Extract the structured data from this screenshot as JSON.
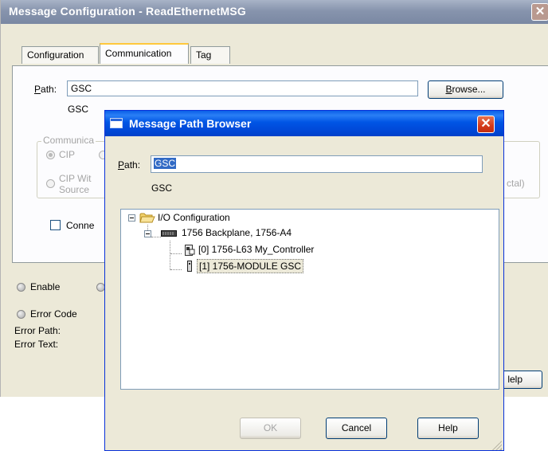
{
  "main_window": {
    "title": "Message Configuration - ReadEthernetMSG",
    "close_glyph": "✕",
    "tabs": [
      "Configuration",
      "Communication",
      "Tag"
    ],
    "path_label": "Path:",
    "path_value": "GSC",
    "path_resolved": "GSC",
    "browse_button": "Browse...",
    "comm_method_group": "Communica",
    "radio_cip": "CIP",
    "radio_cip_with": "CIP Wit",
    "radio_cip_source": "Source",
    "octal_suffix": "ctal)",
    "connected_label": "Conne",
    "enable_label": "Enable",
    "error_code_label": "Error Code",
    "error_path_label": "Error Path:",
    "error_text_label": "Error Text:",
    "help_button_partial": "lelp"
  },
  "dialog": {
    "title": "Message Path Browser",
    "close_glyph": "✕",
    "path_label": "Path:",
    "path_value": "GSC",
    "path_resolved": "GSC",
    "tree": {
      "root": "I/O Configuration",
      "backplane": "1756 Backplane, 1756-A4",
      "children": [
        "[0] 1756-L63 My_Controller",
        "[1] 1756-MODULE GSC"
      ]
    },
    "buttons": {
      "ok": "OK",
      "cancel": "Cancel",
      "help": "Help"
    }
  },
  "colors": {
    "xp_title_active": "#0054e3",
    "xp_title_inactive": "#8794ad",
    "dialog_face": "#ece9d8",
    "selection": "#316ac5"
  }
}
